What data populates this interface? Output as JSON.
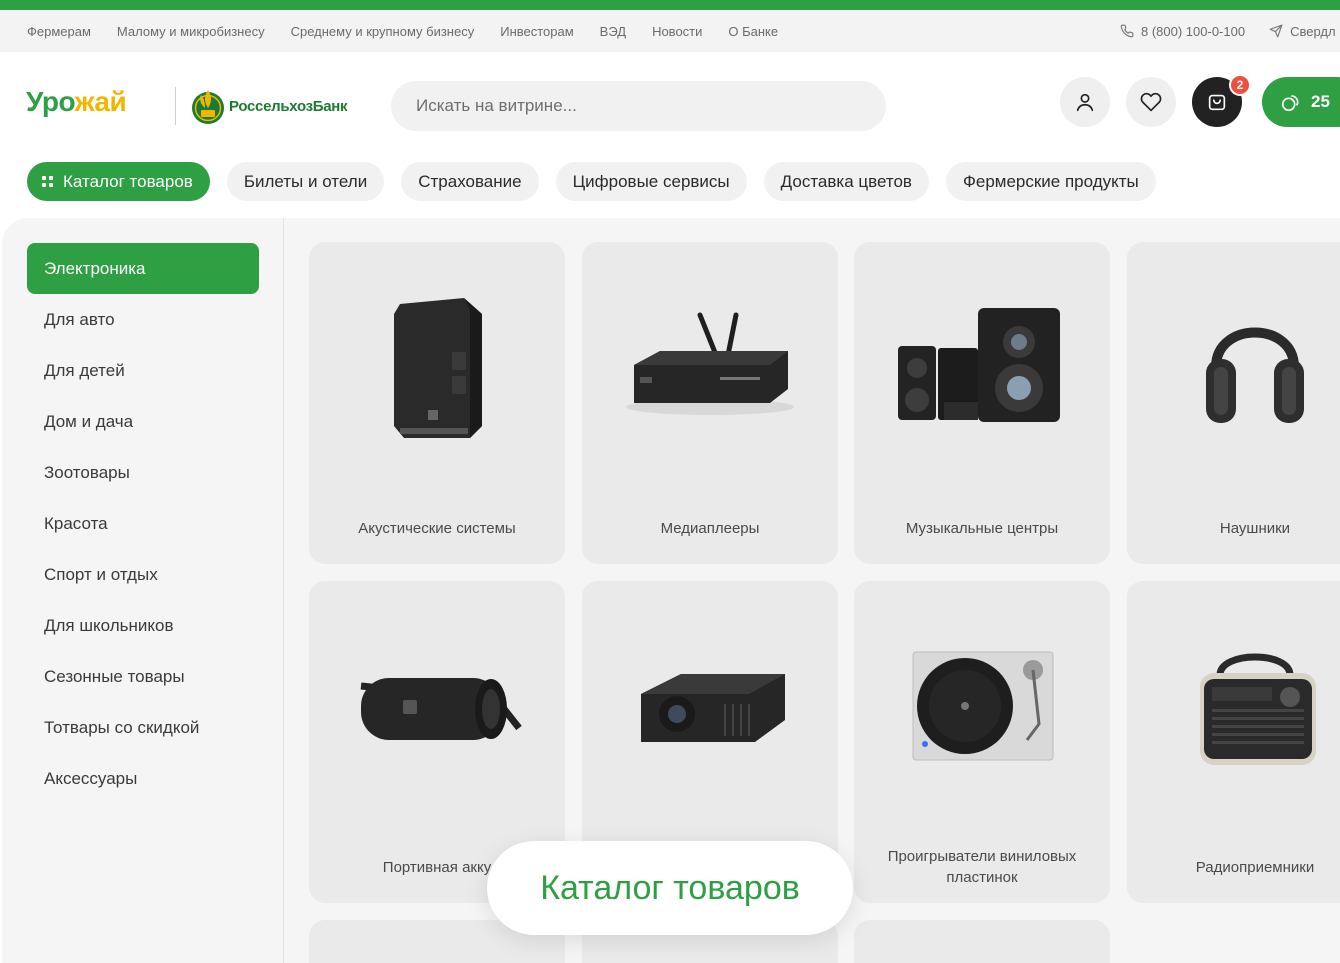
{
  "brand": {
    "colors": {
      "green": "#2ea043",
      "dark_green": "#1b7a34",
      "yellow": "#f2b600",
      "badge_red": "#ee4f3f"
    }
  },
  "top_nav": {
    "links": [
      "Фермерам",
      "Малому и микробизнесу",
      "Среднему и крупному бизнесу",
      "Инвесторам",
      "ВЭД",
      "Новости",
      "О Банке"
    ],
    "phone": "8 (800) 100-0-100",
    "region": "Свердл"
  },
  "header": {
    "logo_primary_a": "Уро",
    "logo_primary_b": "жай",
    "logo_bank": "РоссельхозБанк",
    "search_placeholder": "Искать на витрине...",
    "cart_count": "2",
    "bonus_value": "25"
  },
  "category_nav": {
    "catalog_label": "Каталог товаров",
    "items": [
      "Билеты и отели",
      "Страхование",
      "Цифровые сервисы",
      "Доставка цветов",
      "Фермерские продукты"
    ]
  },
  "sidebar": {
    "items": [
      "Электроника",
      "Для авто",
      "Для детей",
      "Дом и дача",
      "Зоотовары",
      "Красота",
      "Спорт и отдых",
      "Для школьников",
      "Сезонные товары",
      "Тотвары со скидкой",
      "Аксессуары"
    ],
    "active_index": 0
  },
  "products": [
    {
      "label": "Акустические системы",
      "icon": "speaker-icon"
    },
    {
      "label": "Медиаплееры",
      "icon": "media-player-icon"
    },
    {
      "label": "Музыкальные центры",
      "icon": "music-center-icon"
    },
    {
      "label": "Наушники",
      "icon": "headphones-icon"
    },
    {
      "label": "Портивная акку",
      "icon": "portable-speaker-icon"
    },
    {
      "label": "",
      "icon": "projector-icon"
    },
    {
      "label": "Проигрыватели виниловых пластинок",
      "icon": "turntable-icon"
    },
    {
      "label": "Радиоприемники",
      "icon": "radio-icon"
    }
  ],
  "floating_label": "Каталог товаров"
}
